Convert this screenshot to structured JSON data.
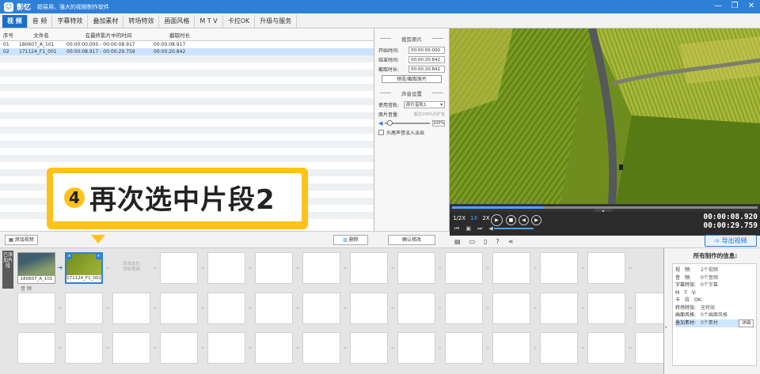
{
  "window": {
    "app_name": "影忆",
    "slogan": "超易用、强大的视频制作软件",
    "minimize": "—",
    "restore": "❐",
    "close": "✕"
  },
  "tabs": [
    "视 频",
    "音 频",
    "字幕特效",
    "叠加素材",
    "转场特效",
    "画面风格",
    "M T V",
    "卡拉OK",
    "升级与服务"
  ],
  "table": {
    "headers": [
      "序号",
      "文件名",
      "在最终影片中的时间",
      "截取时长"
    ],
    "rows": [
      {
        "no": "01",
        "file": "180607_A_101",
        "time": "00:00:00.000 - 00:00:08.917",
        "dur": "00:00:08.917"
      },
      {
        "no": "02",
        "file": "171124_F1_001",
        "time": "00:00:08.917 - 00:00:29.759",
        "dur": "00:00:20.842"
      }
    ]
  },
  "clip_settings": {
    "title": "裁剪原片",
    "start_label": "开始时间:",
    "start_value": "00:00:00.000",
    "end_label": "结束时间:",
    "end_value": "00:00:20.842",
    "dur_label": "截取时长:",
    "dur_value": "00:00:20.842",
    "preview_button": "预览/截取原片"
  },
  "audio_settings": {
    "title": "声音设置",
    "track_label": "使用音轨:",
    "track_value": "原片音轨1",
    "volume_label": "原片音量:",
    "volume_hint": "超过100%为扩音",
    "volume_value": "100%",
    "fade_label": "头尾声音淡入淡出"
  },
  "player": {
    "speeds": [
      "1/2X",
      "1X",
      "2X"
    ],
    "current_time": "00:00:08.920",
    "total_time": "00:00:29.759",
    "progress": 0.3
  },
  "buttons": {
    "add_video": "添加视频",
    "delete": "删除",
    "confirm": "确认修改",
    "export": "导出视频"
  },
  "timeline": {
    "side_label": "已添加片段",
    "clips": [
      {
        "name": "180607_A_101"
      },
      {
        "name": "171124_F1_001"
      }
    ],
    "add_hint": "双击此处\n添加视频",
    "audio_label": "音 频"
  },
  "info": {
    "title": "所有制作的信息:",
    "rows": [
      {
        "k": "视　频:",
        "v": "2个视频"
      },
      {
        "k": "音　频:",
        "v": "0个音频"
      },
      {
        "k": "字幕特效:",
        "v": "0个字幕"
      },
      {
        "k": "M　T　V:",
        "v": ""
      },
      {
        "k": "卡　拉　OK:",
        "v": ""
      },
      {
        "k": "转场特效:",
        "v": "无特效"
      },
      {
        "k": "画面风格:",
        "v": "0个画面风格"
      },
      {
        "k": "叠加素材:",
        "v": "0个素材"
      }
    ],
    "detail_button": "详细"
  },
  "callout": {
    "step": "4",
    "text": "再次选中片段2"
  },
  "colors": {
    "accent": "#2e7fd6",
    "callout": "#ffc21a"
  }
}
